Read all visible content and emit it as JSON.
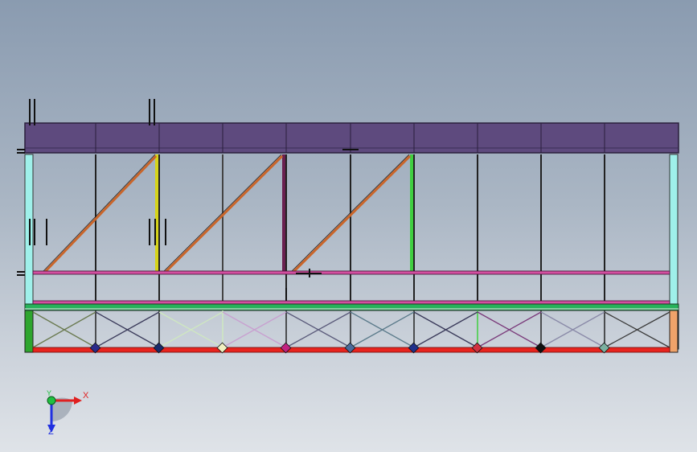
{
  "viewport": {
    "background_top": "#8a9bb0",
    "background_bottom": "#dfe3e8"
  },
  "model": {
    "beam_color": "#5e4a7e",
    "post_color": "#9ff0ea",
    "brace_color": "#c9652a",
    "rail_color": "#d34fa0",
    "deck_color": "#26b25a",
    "bottom_chord_color": "#e8241e",
    "left_end_color": "#2ea52e",
    "right_end_color": "#f0a36a"
  },
  "triad": {
    "x_label": "X",
    "y_label": "Y",
    "z_label": "Z",
    "x_color": "#e02020",
    "y_color": "#20c040",
    "z_color": "#2030e0"
  }
}
